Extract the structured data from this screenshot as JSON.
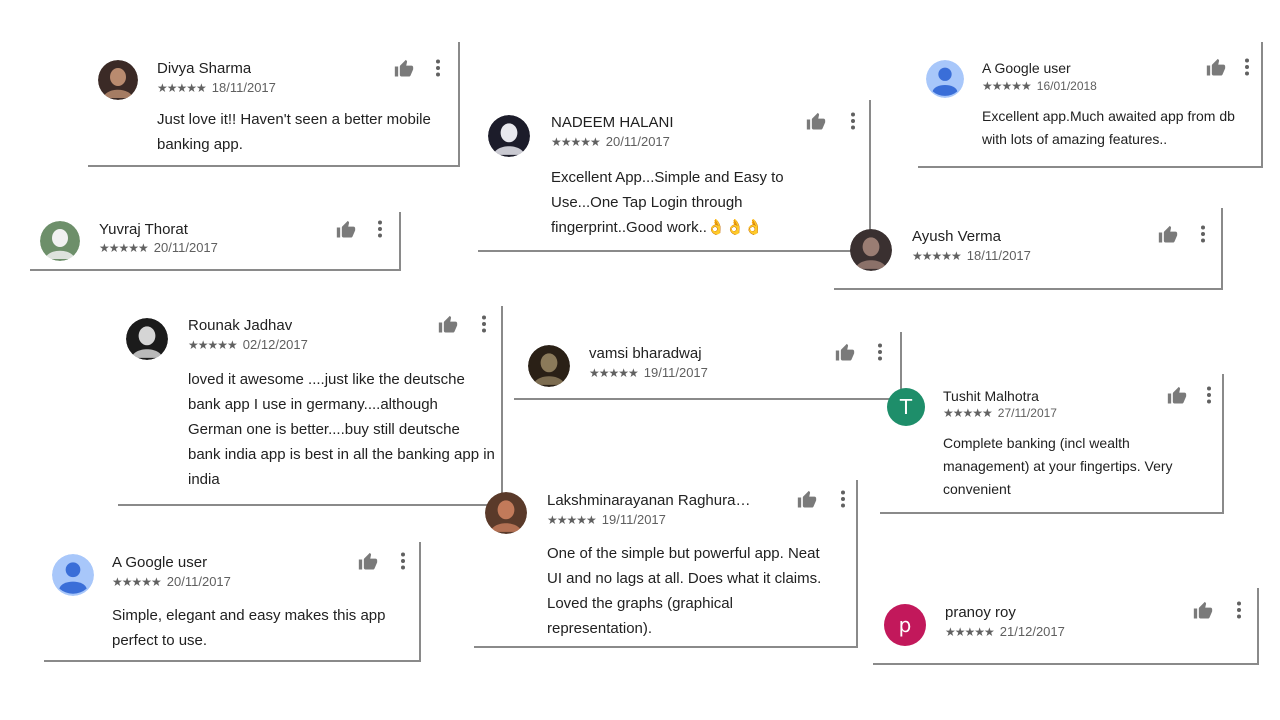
{
  "stars_glyph": "★★★★★",
  "reviews": [
    {
      "id": "divya",
      "name": "Divya Sharma",
      "date": "18/11/2017",
      "text": "Just love it!! Haven't seen a better mobile banking app.",
      "avatar": {
        "kind": "photo",
        "colors": [
          "#3b2a26",
          "#b98b6f"
        ]
      }
    },
    {
      "id": "nadeem",
      "name": "NADEEM HALANI",
      "date": "20/11/2017",
      "text": "Excellent App...Simple and Easy to Use...One Tap Login through fingerprint..Good work..👌👌👌",
      "avatar": {
        "kind": "photo",
        "colors": [
          "#1c1c2a",
          "#e8e8ee"
        ]
      }
    },
    {
      "id": "google1",
      "name": "A Google user",
      "date": "16/01/2018",
      "text": "Excellent app.Much awaited app from db with lots of amazing features..",
      "avatar": {
        "kind": "google",
        "colors": [
          "#a8c7fa",
          "#3a6ed8"
        ]
      }
    },
    {
      "id": "yuvraj",
      "name": "Yuvraj Thorat",
      "date": "20/11/2017",
      "text": "",
      "avatar": {
        "kind": "photo",
        "colors": [
          "#6d8f6a",
          "#f1f1f1"
        ]
      }
    },
    {
      "id": "ayush",
      "name": "Ayush Verma",
      "date": "18/11/2017",
      "text": "",
      "avatar": {
        "kind": "photo",
        "colors": [
          "#3a3030",
          "#9a7d73"
        ]
      }
    },
    {
      "id": "rounak",
      "name": "Rounak Jadhav",
      "date": "02/12/2017",
      "text": "loved it awesome ....just like the deutsche bank app I use in germany....although German one is better....buy still deutsche bank india app is best in all the banking app in india",
      "avatar": {
        "kind": "photo",
        "colors": [
          "#1b1b1b",
          "#d5d5d5"
        ]
      }
    },
    {
      "id": "vamsi",
      "name": "vamsi bharadwaj",
      "date": "19/11/2017",
      "text": "",
      "avatar": {
        "kind": "photo",
        "colors": [
          "#2a2016",
          "#8b7a5a"
        ]
      }
    },
    {
      "id": "tushit",
      "name": "Tushit Malhotra",
      "date": "27/11/2017",
      "text": "Complete banking (incl wealth management) at your fingertips. Very convenient",
      "avatar": {
        "kind": "letter",
        "letter": "T",
        "colors": [
          "#1e8e6a"
        ]
      }
    },
    {
      "id": "lakshmi",
      "name": "Lakshminarayanan Raghura…",
      "date": "19/11/2017",
      "text": "One of the simple but powerful app. Neat UI and no lags at all. Does what it claims. Loved the graphs (graphical representation).",
      "avatar": {
        "kind": "photo",
        "colors": [
          "#5a3a2a",
          "#c27a5a"
        ]
      }
    },
    {
      "id": "google2",
      "name": "A Google user",
      "date": "20/11/2017",
      "text": "Simple, elegant and easy makes this app perfect to use.",
      "avatar": {
        "kind": "google",
        "colors": [
          "#a8c7fa",
          "#3a6ed8"
        ]
      }
    },
    {
      "id": "pranoy",
      "name": "pranoy roy",
      "date": "21/12/2017",
      "text": "",
      "avatar": {
        "kind": "letter",
        "letter": "p",
        "colors": [
          "#c2185b"
        ]
      }
    }
  ]
}
